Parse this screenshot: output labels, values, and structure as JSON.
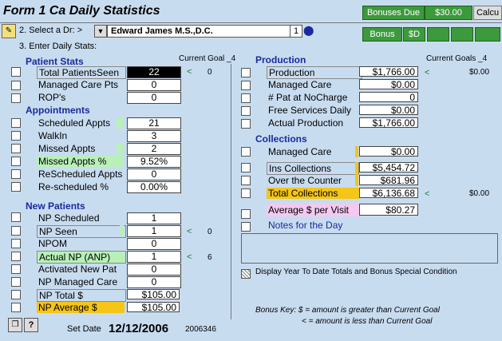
{
  "header": {
    "form_title": "Form 1   Ca Daily Statistics",
    "bonuses_due_label": "Bonuses Due",
    "bonuses_due_value": "$30.00",
    "calc_label": "Calcu"
  },
  "dr_select": {
    "step_label": "2. Select a Dr: >",
    "doctor": "Edward   James M.S.,D.C.",
    "index": "1"
  },
  "tabs": {
    "bonus": "Bonus",
    "sd": "$D"
  },
  "enter_label": "3. Enter Daily Stats:",
  "left": {
    "current_goal_label": "Current Goal _4",
    "patient_stats": {
      "title": "Patient Stats",
      "rows": [
        {
          "label": "Total PatientsSeen",
          "value": "22",
          "goal": "0"
        },
        {
          "label": "Managed Care Pts",
          "value": "0"
        },
        {
          "label": " ROP's",
          "value": "0"
        }
      ]
    },
    "appointments": {
      "title": "Appointments",
      "rows": [
        {
          "label": "Scheduled Appts",
          "value": "21"
        },
        {
          "label": "WalkIn",
          "value": "3"
        },
        {
          "label": "Missed Appts",
          "value": "2"
        },
        {
          "label": "Missed Appts %",
          "value": "9.52%"
        },
        {
          "label": "ReScheduled Appts",
          "value": "0"
        },
        {
          "label": "Re-scheduled %",
          "value": "0.00%"
        }
      ]
    },
    "new_patients": {
      "title": "New Patients",
      "rows": [
        {
          "label": "NP Scheduled",
          "value": "1"
        },
        {
          "label": "NP Seen",
          "value": "1",
          "goal": "0"
        },
        {
          "label": "NPOM",
          "value": "0"
        },
        {
          "label": "Actual NP (ANP)",
          "value": "1",
          "goal": "6"
        },
        {
          "label": "Activated New Pat",
          "value": "0"
        },
        {
          "label": "NP Managed Care",
          "value": "0"
        },
        {
          "label": "NP Total $",
          "value": "$105.00"
        },
        {
          "label": "NP Average $",
          "value": "$105.00"
        }
      ]
    }
  },
  "right": {
    "current_goals_label": "Current Goals _4",
    "production": {
      "title": "Production",
      "rows": [
        {
          "label": "Production",
          "value": "$1,766.00",
          "goal": "$0.00"
        },
        {
          "label": "Managed Care",
          "value": "$0.00"
        },
        {
          "label": "# Pat at NoCharge",
          "value": "0"
        },
        {
          "label": "Free Services Daily",
          "value": "$0.00"
        },
        {
          "label": "Actual Production",
          "value": "$1,766.00"
        }
      ]
    },
    "collections": {
      "title": "Collections",
      "rows": [
        {
          "label": "Managed Care",
          "value": "$0.00"
        },
        {
          "label": "Ins Collections",
          "value": "$5,454.72"
        },
        {
          "label": "Over the Counter",
          "value": "$681.96"
        },
        {
          "label": "Total Collections",
          "value": "$6,136.68",
          "goal": "$0.00"
        }
      ]
    },
    "avg_visit": {
      "label": "Average $ per Visit",
      "value": "$80.27"
    },
    "notes_label": "Notes for the Day",
    "ytd_label": "Display Year To Date Totals and Bonus Special Condition",
    "bonus_key_line1": "Bonus Key:  $ =  amount  is greater than Current Goal",
    "bonus_key_line2": "< =  amount is less than Current Goal"
  },
  "footer": {
    "set_date_label": "Set Date",
    "date": "12/12/2006",
    "date_code": "2006346"
  },
  "arrow_glyph": "<"
}
